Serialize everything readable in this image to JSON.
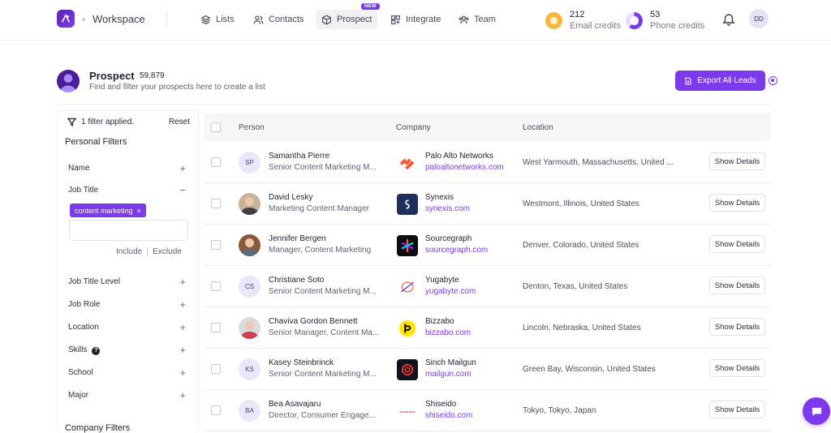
{
  "app": {
    "workspace_name": "Workspace"
  },
  "nav": {
    "items": [
      {
        "label": "Lists",
        "icon": "layers-icon"
      },
      {
        "label": "Contacts",
        "icon": "users-icon"
      },
      {
        "label": "Prospect",
        "icon": "cube-icon",
        "badge": "NEW",
        "active": true
      },
      {
        "label": "Integrate",
        "icon": "grid-plus-icon"
      },
      {
        "label": "Team",
        "icon": "team-icon"
      }
    ]
  },
  "credits": {
    "email": {
      "value": "212",
      "label": "Email credits",
      "color": "#f6b73c"
    },
    "phone": {
      "value": "53",
      "label": "Phone credits",
      "color": "#7c3aed"
    }
  },
  "user": {
    "initials": "DD"
  },
  "page": {
    "title": "Prospect",
    "count": "59,879",
    "subtitle": "Find and filter your prospects here to create a list",
    "export_label": "Export All Leads"
  },
  "filters": {
    "applied_text": "1 filter applied.",
    "reset_label": "Reset",
    "personal_heading": "Personal Filters",
    "company_heading": "Company Filters",
    "items": {
      "name": "Name",
      "job_title": "Job Title",
      "job_title_level": "Job Title Level",
      "job_role": "Job Role",
      "location": "Location",
      "skills": "Skills",
      "school": "School",
      "major": "Major"
    },
    "job_title_tag": "content marketing",
    "include_label": "Include",
    "exclude_label": "Exclude"
  },
  "table": {
    "headers": {
      "person": "Person",
      "company": "Company",
      "location": "Location"
    },
    "action_label": "Show Details",
    "rows": [
      {
        "initials": "SP",
        "photo": false,
        "name": "Samantha Pierre",
        "title": "Senior Content Marketing M...",
        "company": "Palo Alto Networks",
        "domain": "paloaltonetworks.com",
        "location": "West Yarmouth, Massachusetts, United ...",
        "logo": "paloalto-logo"
      },
      {
        "initials": "",
        "photo": true,
        "name": "David Lesky",
        "title": "Marketing Content Manager",
        "company": "Synexis",
        "domain": "synexis.com",
        "location": "Westmont, Illinois, United States",
        "logo": "synexis-logo"
      },
      {
        "initials": "",
        "photo": true,
        "name": "Jennifer Bergen",
        "title": "Manager, Content Marketing",
        "company": "Sourcegraph",
        "domain": "sourcegraph.com",
        "location": "Denver, Colorado, United States",
        "logo": "sourcegraph-logo"
      },
      {
        "initials": "CS",
        "photo": false,
        "name": "Christiane Soto",
        "title": "Senior Content Marketing M...",
        "company": "Yugabyte",
        "domain": "yugabyte.com",
        "location": "Denton, Texas, United States",
        "logo": "yugabyte-logo"
      },
      {
        "initials": "",
        "photo": true,
        "name": "Chaviva Gordon Bennett",
        "title": "Senior Manager, Content Ma...",
        "company": "Bizzabo",
        "domain": "bizzabo.com",
        "location": "Lincoln, Nebraska, United States",
        "logo": "bizzabo-logo"
      },
      {
        "initials": "KS",
        "photo": false,
        "name": "Kasey Steinbrinck",
        "title": "Senior Content Marketing M...",
        "company": "Sinch Mailgun",
        "domain": "mailgun.com",
        "location": "Green Bay, Wisconsin, United States",
        "logo": "mailgun-logo"
      },
      {
        "initials": "BA",
        "photo": false,
        "name": "Bea Asavajaru",
        "title": "Director, Consumer Engage...",
        "company": "Shiseido",
        "domain": "shiseido.com",
        "location": "Tokyo, Tokyo, Japan",
        "logo": "shiseido-logo"
      }
    ]
  },
  "colors": {
    "accent": "#7c3aed",
    "link": "#7c3aed"
  }
}
